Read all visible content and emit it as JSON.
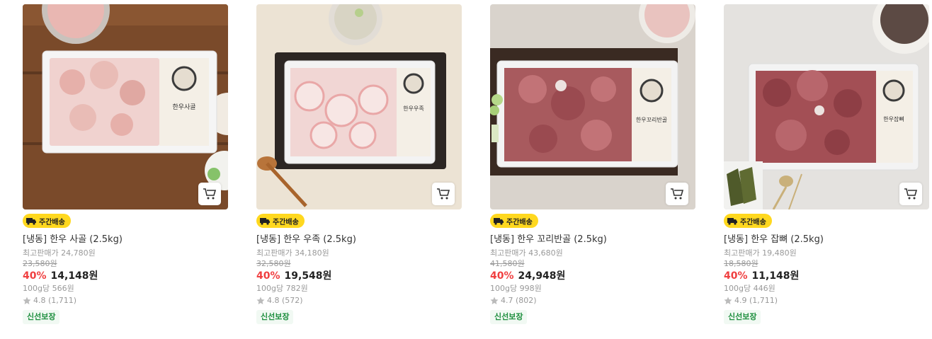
{
  "products": [
    {
      "badge": "주간배송",
      "name": "[냉동] 한우 사골 (2.5kg)",
      "max_price": "최고판매가 24,780원",
      "original_price": "23,580원",
      "discount": "40%",
      "price": "14,148원",
      "unit_price": "100g당 566원",
      "rating": "4.8 (1,711)",
      "tag": "신선보장",
      "package_label": "한우사골"
    },
    {
      "badge": "주간배송",
      "name": "[냉동] 한우 우족 (2.5kg)",
      "max_price": "최고판매가 34,180원",
      "original_price": "32,580원",
      "discount": "40%",
      "price": "19,548원",
      "unit_price": "100g당 782원",
      "rating": "4.8 (572)",
      "tag": "신선보장",
      "package_label": "한우우족"
    },
    {
      "badge": "주간배송",
      "name": "[냉동] 한우 꼬리반골 (2.5kg)",
      "max_price": "최고판매가 43,680원",
      "original_price": "41,580원",
      "discount": "40%",
      "price": "24,948원",
      "unit_price": "100g당 998원",
      "rating": "4.7 (802)",
      "tag": "신선보장",
      "package_label": "한우꼬리반골"
    },
    {
      "badge": "주간배송",
      "name": "[냉동] 한우 잡뼈 (2.5kg)",
      "max_price": "최고판매가 19,480원",
      "original_price": "18,580원",
      "discount": "40%",
      "price": "11,148원",
      "unit_price": "100g당 446원",
      "rating": "4.9 (1,711)",
      "tag": "신선보장",
      "package_label": "한우잡뼈"
    }
  ],
  "icons": {
    "cart": "cart-icon",
    "truck": "truck-icon",
    "star": "star-icon"
  },
  "colors": {
    "discount": "#f03f40",
    "badge": "#ffd81f",
    "fresh_text": "#1c8e3d",
    "fresh_bg": "#f1f9f3"
  }
}
